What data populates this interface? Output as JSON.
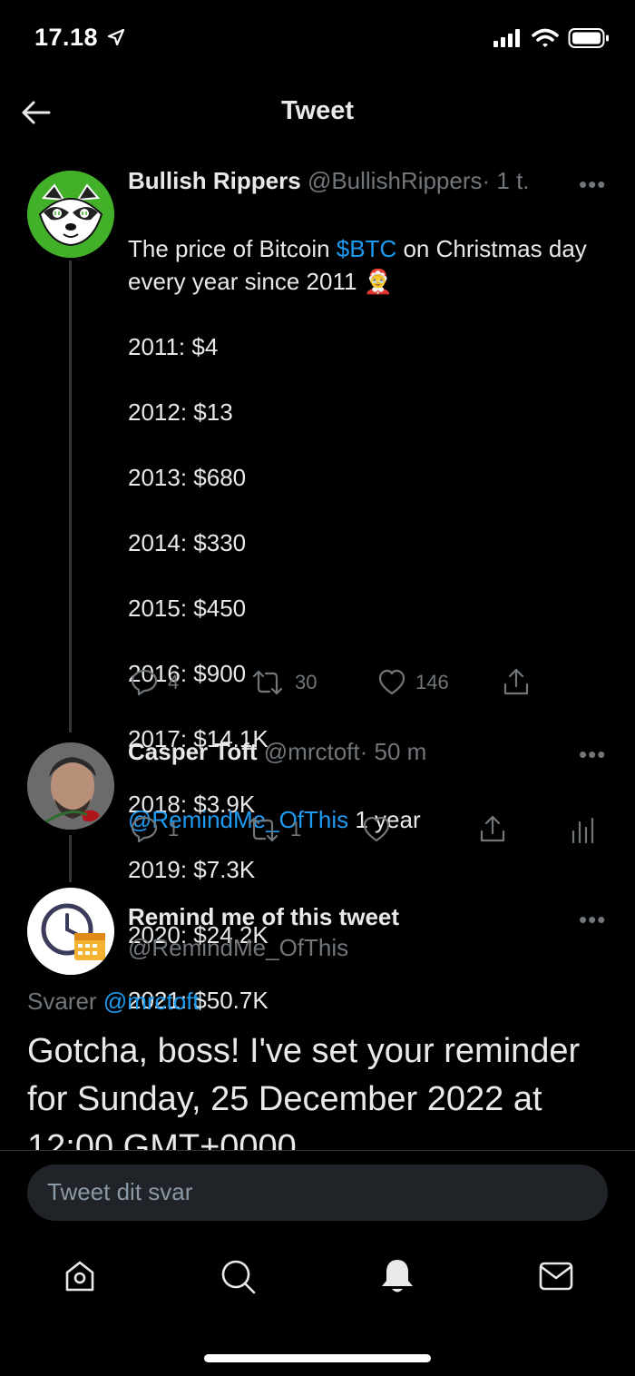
{
  "status_bar": {
    "time": "17.18"
  },
  "header": {
    "title": "Tweet"
  },
  "tweets": [
    {
      "name": "Bullish Rippers",
      "handle": "@BullishRippers",
      "time": "· 1 t.",
      "text_parts": {
        "t1": "The price of Bitcoin ",
        "link": "$BTC",
        "t2": " on Christmas day every year since 2011 "
      },
      "emoji": "🤶",
      "lines": [
        "2011: $4",
        "2012: $13",
        "2013: $680",
        "2014: $330",
        "2015: $450",
        "2016: $900",
        "2017: $14.1K",
        "2018: $3.9K",
        "2019: $7.3K",
        "2020: $24.2K",
        "2021: $50.7K"
      ],
      "replies": "4",
      "retweets": "30",
      "likes": "146"
    },
    {
      "name": "Casper Toft",
      "handle": "@mrctoft",
      "time": "· 50 m",
      "mention": "@RemindMe_OfThis",
      "text": " 1 year",
      "replies": "1",
      "retweets": "1"
    },
    {
      "name": "Remind me of this tweet",
      "handle": "@RemindMe_OfThis",
      "replying_prefix": "Svarer ",
      "replying_to": "@mrctoft",
      "text": "Gotcha, boss! I've set your reminder for Sunday, 25 December 2022 at 12:00 GMT+0000"
    }
  ],
  "reply_input": {
    "placeholder": "Tweet dit svar"
  },
  "more_label": "•••"
}
